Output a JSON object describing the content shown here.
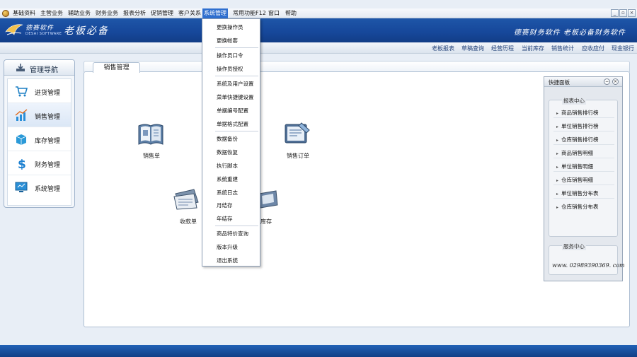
{
  "menubar": {
    "items": [
      "基础资料",
      "主营业务",
      "辅助业务",
      "财务业务",
      "报表分析",
      "促销管理",
      "客户关系",
      "系统管理",
      "常用功能F12",
      "窗口",
      "帮助"
    ],
    "active_index": 7,
    "window_buttons": [
      "_",
      "▫",
      "×"
    ]
  },
  "banner": {
    "logo_cn": "德赛软件",
    "logo_en": "DESAI SOFTWARE",
    "title": "老板必备",
    "slogan": "德赛财务软件 老板必备财务软件"
  },
  "quicknav": {
    "links": [
      "老板报表",
      "草稿查询",
      "经营历程",
      "当前库存",
      "销售统计",
      "应收应付",
      "现金银行"
    ]
  },
  "nav": {
    "title": "管理导航",
    "items": [
      "进货管理",
      "销售管理",
      "库存管理",
      "财务管理",
      "系统管理"
    ],
    "active_index": 1
  },
  "tab": {
    "label": "销售管理"
  },
  "functions": {
    "sales_order": "销售单",
    "sales_booking": "销售订单",
    "receipt": "收款单",
    "stock": "库存"
  },
  "dropdown": {
    "groups": [
      [
        "更换操作员",
        "更换帐套"
      ],
      [
        "操作员口令",
        "操作员授权"
      ],
      [
        "系统及用户设置",
        "菜单快捷键设置",
        "单据编号配置",
        "单据格式配置"
      ],
      [
        "数据备份",
        "数据恢复",
        "执行脚本",
        "系统重建",
        "系统日志",
        "月结存",
        "年结存"
      ],
      [
        "商品特价查询",
        "版本升级",
        "退出系统"
      ]
    ]
  },
  "quick_panel": {
    "title": "快捷面板",
    "reports_legend": "报表中心",
    "reports": [
      "商品销售排行榜",
      "单位销售排行榜",
      "仓库销售排行榜",
      "商品销售明细",
      "单位销售明细",
      "仓库销售明细",
      "单位销售分布表",
      "仓库销售分布表"
    ],
    "service_legend": "服务中心",
    "phone": "www. 02989390369. com"
  },
  "colors": {
    "banner": "#1a4f9f",
    "menu_active": "#2f6fcf",
    "bottom_bar": "#123f86"
  }
}
